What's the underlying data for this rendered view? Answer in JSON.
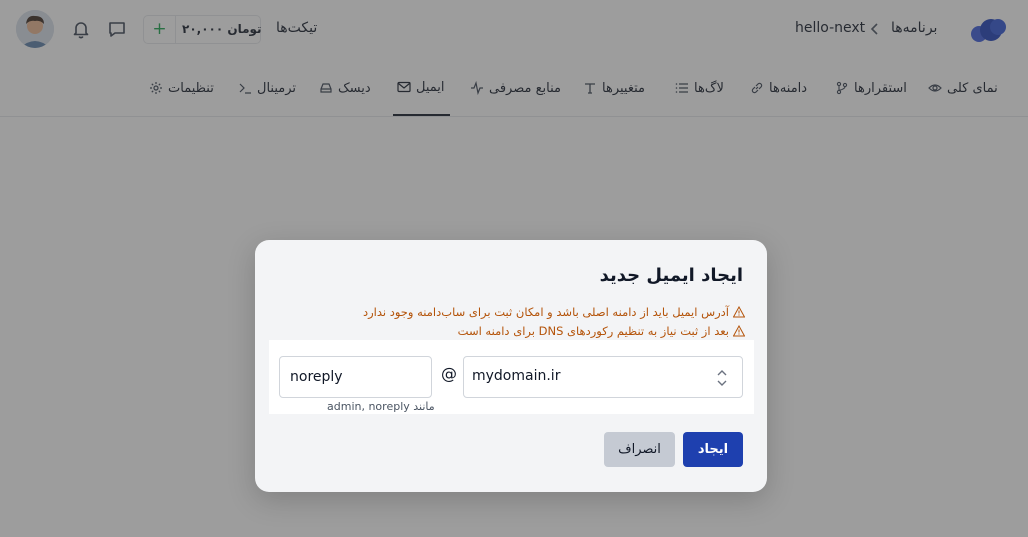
{
  "header": {
    "breadcrumb": {
      "programs": "برنامه‌ها",
      "app": "hello-next"
    },
    "tickets": "تیکت‌ها",
    "balance": "۲۰,۰۰۰ تومان",
    "balance_add": "+",
    "icons": [
      "chat-icon",
      "bell-icon",
      "avatar"
    ]
  },
  "tabs": [
    {
      "label": "نمای کلی",
      "icon": "eye-icon"
    },
    {
      "label": "استقرارها",
      "icon": "git-branch-icon"
    },
    {
      "label": "دامنه‌ها",
      "icon": "link-icon"
    },
    {
      "label": "لاگ‌ها",
      "icon": "list-icon"
    },
    {
      "label": "متغییرها",
      "icon": "text-icon"
    },
    {
      "label": "منابع مصرفی",
      "icon": "activity-icon"
    },
    {
      "label": "ایمیل",
      "icon": "mail-icon",
      "active": true
    },
    {
      "label": "دیسک",
      "icon": "disk-icon"
    },
    {
      "label": "ترمینال",
      "icon": "terminal-icon"
    },
    {
      "label": "تنظیمات",
      "icon": "gear-icon"
    }
  ],
  "modal": {
    "title": "ایجاد ایمیل جدید",
    "warnings": [
      "آدرس ایمیل باید از دامنه اصلی باشد و امکان ثبت برای ساب‌دامنه وجود ندارد",
      "بعد از ثبت نیاز به تنظیم رکوردهای DNS برای دامنه است"
    ],
    "domain": "mydomain.ir",
    "at": "@",
    "local_part": "noreply",
    "hint": "مانند admin, noreply",
    "create_label": "ایجاد",
    "cancel_label": "انصراف"
  },
  "colors": {
    "primary": "#1e40af",
    "warning": "#b45309",
    "overlay": "rgba(60,60,60,0.5)"
  }
}
